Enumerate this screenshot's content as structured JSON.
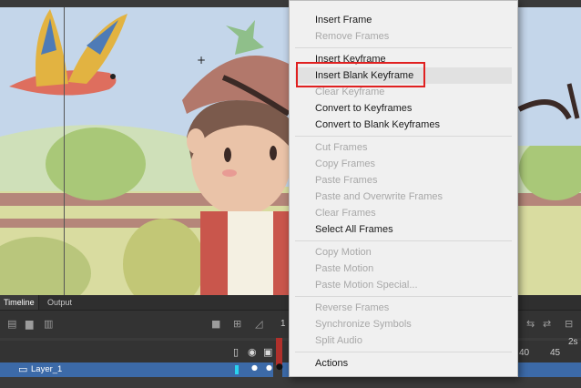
{
  "timeline": {
    "tabs": [
      "Timeline",
      "Output"
    ],
    "layer_name": "Layer_1",
    "ruler_numbers": [
      "1",
      "40",
      "45"
    ],
    "fps_label": "2s"
  },
  "context_menu": {
    "items": [
      {
        "label": "Insert Frame",
        "enabled": true
      },
      {
        "label": "Remove Frames",
        "enabled": false
      },
      {
        "label": "Insert Keyframe",
        "enabled": true
      },
      {
        "label": "Insert Blank Keyframe",
        "enabled": true,
        "highlighted": true
      },
      {
        "label": "Clear Keyframe",
        "enabled": false
      },
      {
        "label": "Convert to Keyframes",
        "enabled": true
      },
      {
        "label": "Convert to Blank Keyframes",
        "enabled": true
      },
      {
        "label": "Cut Frames",
        "enabled": false
      },
      {
        "label": "Copy Frames",
        "enabled": false
      },
      {
        "label": "Paste Frames",
        "enabled": false
      },
      {
        "label": "Paste and Overwrite Frames",
        "enabled": false
      },
      {
        "label": "Clear Frames",
        "enabled": false
      },
      {
        "label": "Select All Frames",
        "enabled": true
      },
      {
        "label": "Copy Motion",
        "enabled": false
      },
      {
        "label": "Paste Motion",
        "enabled": false
      },
      {
        "label": "Paste Motion Special...",
        "enabled": false
      },
      {
        "label": "Reverse Frames",
        "enabled": false
      },
      {
        "label": "Synchronize Symbols",
        "enabled": false
      },
      {
        "label": "Split Audio",
        "enabled": false
      },
      {
        "label": "Actions",
        "enabled": true
      }
    ]
  },
  "colors": {
    "highlight_box": "#e02020",
    "layer_selected": "#3c6aa8",
    "playhead": "#b0302b"
  }
}
